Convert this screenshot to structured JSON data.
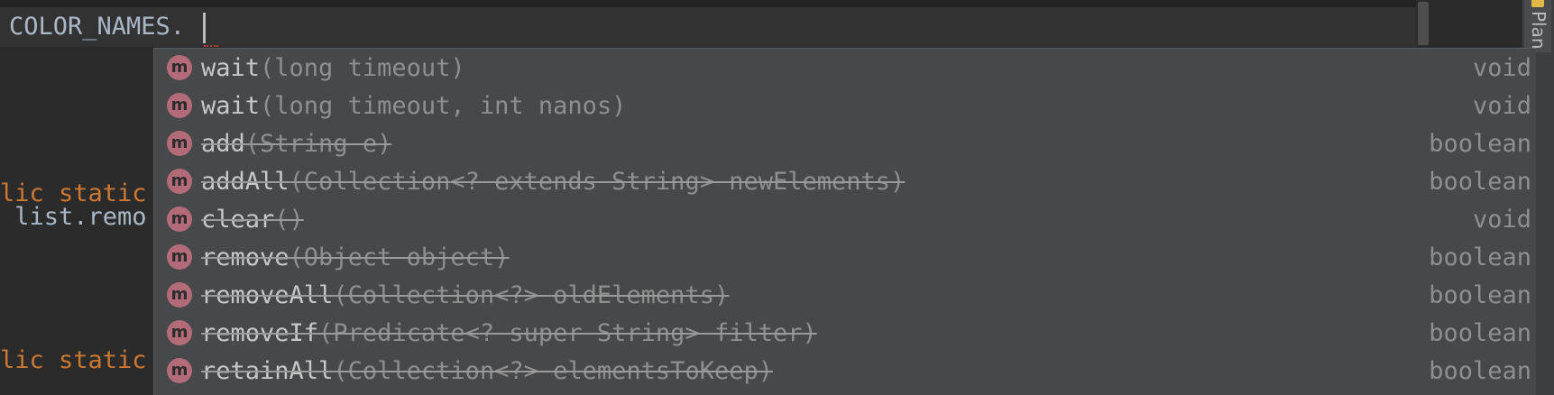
{
  "editor": {
    "current_line": "COLOR_NAMES.",
    "bg_lines": [
      {
        "text": "lic static",
        "keyword": true
      },
      {
        "text": " list.remo",
        "keyword": false
      },
      {
        "text": "lic static",
        "keyword": true
      }
    ]
  },
  "tool_window": {
    "plan_label": "Plan"
  },
  "completion": {
    "icon_letter": "m",
    "items": [
      {
        "name": "wait",
        "params": "(long timeout)",
        "return_type": "void",
        "deprecated": false
      },
      {
        "name": "wait",
        "params": "(long timeout, int nanos)",
        "return_type": "void",
        "deprecated": false
      },
      {
        "name": "add",
        "params": "(String e)",
        "return_type": "boolean",
        "deprecated": true
      },
      {
        "name": "addAll",
        "params": "(Collection<? extends String> newElements)",
        "return_type": "boolean",
        "deprecated": true
      },
      {
        "name": "clear",
        "params": "()",
        "return_type": "void",
        "deprecated": true
      },
      {
        "name": "remove",
        "params": "(Object object)",
        "return_type": "boolean",
        "deprecated": true
      },
      {
        "name": "removeAll",
        "params": "(Collection<?> oldElements)",
        "return_type": "boolean",
        "deprecated": true
      },
      {
        "name": "removeIf",
        "params": "(Predicate<? super String> filter)",
        "return_type": "boolean",
        "deprecated": true
      },
      {
        "name": "retainAll",
        "params": "(Collection<?> elementsToKeep)",
        "return_type": "boolean",
        "deprecated": true
      }
    ]
  },
  "colors": {
    "editor_bg": "#2b2b2b",
    "popup_bg": "#46484a",
    "method_icon": "#b36b79",
    "keyword": "#cc7832"
  }
}
